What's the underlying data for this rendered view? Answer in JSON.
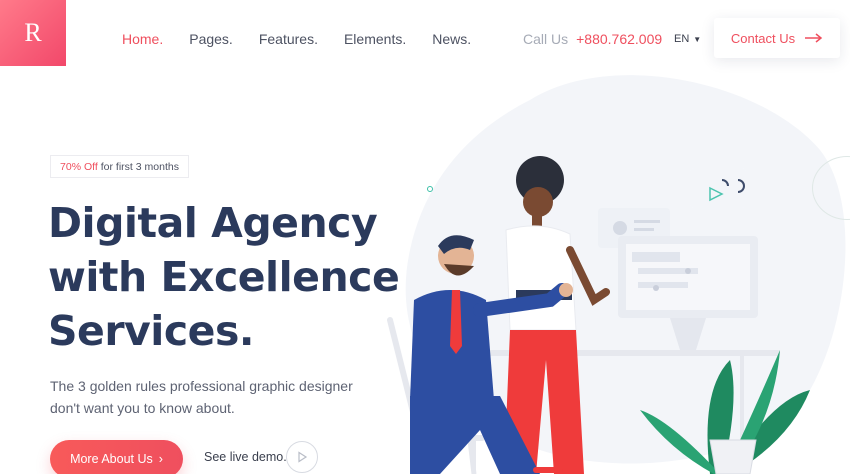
{
  "brand": {
    "logo_letter": "R",
    "accent": "#ef4f5e",
    "navy": "#2b3a5c"
  },
  "nav": {
    "items": [
      {
        "label": "Home.",
        "active": true
      },
      {
        "label": "Pages.",
        "active": false
      },
      {
        "label": "Features.",
        "active": false
      },
      {
        "label": "Elements.",
        "active": false
      },
      {
        "label": "News.",
        "active": false
      }
    ]
  },
  "header": {
    "call_label": "Call Us",
    "phone": "+880.762.009",
    "language": "EN",
    "contact_label": "Contact Us"
  },
  "hero": {
    "promo_highlight": "70% Off",
    "promo_rest": "for first 3 months",
    "headline_line1": "Digital Agency",
    "headline_line2": "with Excellence",
    "headline_line3": "Services.",
    "subtitle": "The 3 golden rules professional graphic designer don't want you to know about.",
    "primary_button": "More About Us",
    "demo_link": "See live demo."
  },
  "icons": {
    "arrow": "arrow-right-icon",
    "caret": "caret-down-icon",
    "chevron": "chevron-right-icon",
    "play": "play-icon"
  }
}
